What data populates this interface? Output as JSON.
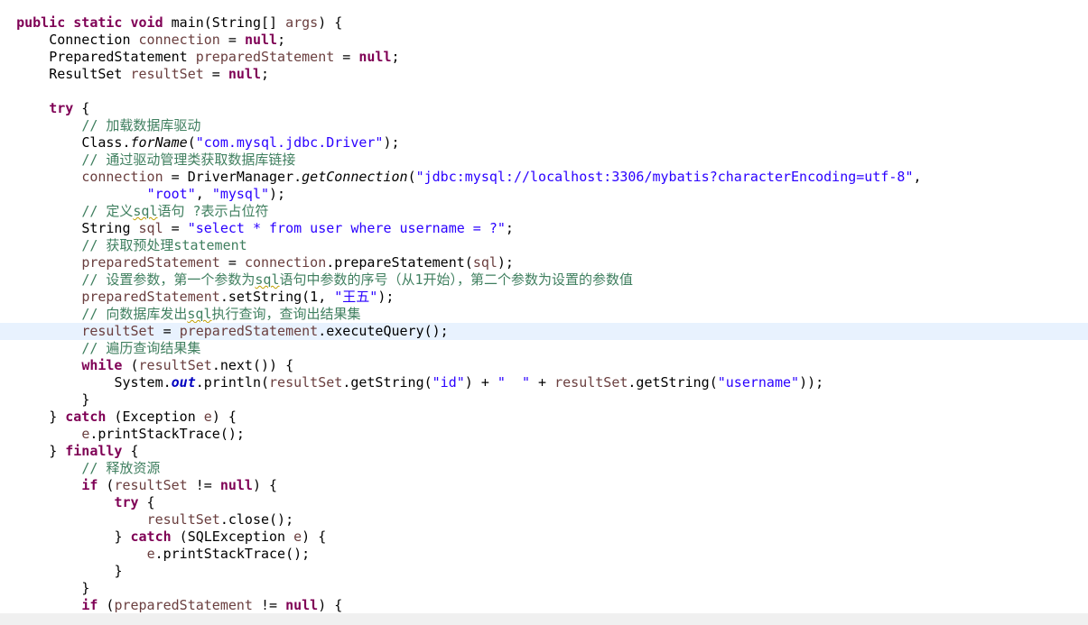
{
  "lines": {
    "l0": {
      "a": "public",
      "b": "static",
      "c": "void",
      "d": " main(String[] ",
      "e": "args",
      ")": ") {"
    },
    "l1": {
      "a": "Connection ",
      "b": "connection",
      "c": " = ",
      "d": "null",
      ";": ";"
    },
    "l2": {
      "a": "PreparedStatement ",
      "b": "preparedStatement",
      "c": " = ",
      "d": "null",
      ";": ";"
    },
    "l3": {
      "a": "ResultSet ",
      "b": "resultSet",
      "c": " = ",
      "d": "null",
      ";": ";"
    },
    "l5": {
      "a": "try",
      "b": " {"
    },
    "l6": {
      "a": "// 加载数据库驱动"
    },
    "l7": {
      "a": "Class.",
      "b": "forName",
      "c": "(",
      "d": "\"com.mysql.jdbc.Driver\"",
      "e": ");"
    },
    "l8": {
      "a": "// 通过驱动管理类获取数据库链接"
    },
    "l9": {
      "a": "connection",
      "b": " = DriverManager.",
      "c": "getConnection",
      "d": "(",
      "e": "\"jdbc:mysql://localhost:3306/mybatis?characterEncoding=utf-8\"",
      "f": ","
    },
    "l10": {
      "a": "\"root\"",
      "b": ", ",
      "c": "\"mysql\"",
      "d": ");"
    },
    "l11": {
      "a": "// 定义",
      "b": "sql",
      "c": "语句 ?表示占位符"
    },
    "l12": {
      "a": "String ",
      "b": "sql",
      "c": " = ",
      "d": "\"select * from user where username = ?\"",
      "e": ";"
    },
    "l13": {
      "a": "// 获取预处理statement"
    },
    "l14": {
      "a": "preparedStatement",
      "b": " = ",
      "c": "connection",
      "d": ".prepareStatement(",
      "e": "sql",
      "f": ");"
    },
    "l15": {
      "a": "// 设置参数，第一个参数为",
      "b": "sql",
      "c": "语句中参数的序号（从1开始），第二个参数为设置的参数值"
    },
    "l16": {
      "a": "preparedStatement",
      "b": ".setString(1, ",
      "c": "\"王五\"",
      "d": ");"
    },
    "l17": {
      "a": "// 向数据库发出",
      "b": "sql",
      "c": "执行查询，查询出结果集"
    },
    "l18": {
      "a": "resultSet",
      "b": " = ",
      "c": "preparedStatement",
      "d": ".executeQuery();"
    },
    "l19": {
      "a": "// 遍历查询结果集"
    },
    "l20": {
      "a": "while",
      "b": " (",
      "c": "resultSet",
      "d": ".next()) {"
    },
    "l21": {
      "a": "System.",
      "b": "out",
      "c": ".println(",
      "d": "resultSet",
      "e": ".getString(",
      "f": "\"id\"",
      "g": ") + ",
      "h": "\"  \"",
      "i": " + ",
      "j": "resultSet",
      "k": ".getString(",
      "l": "\"username\"",
      "m": "));"
    },
    "l22": {
      "a": "}"
    },
    "l23": {
      "a": "} ",
      "b": "catch",
      "c": " (Exception ",
      "d": "e",
      "e": ") {"
    },
    "l24": {
      "a": "e",
      "b": ".printStackTrace();"
    },
    "l25": {
      "a": "} ",
      "b": "finally",
      "c": " {"
    },
    "l26": {
      "a": "// 释放资源"
    },
    "l27": {
      "a": "if",
      "b": " (",
      "c": "resultSet",
      "d": " != ",
      "e": "null",
      "f": ") {"
    },
    "l28": {
      "a": "try",
      "b": " {"
    },
    "l29": {
      "a": "resultSet",
      "b": ".close();"
    },
    "l30": {
      "a": "} ",
      "b": "catch",
      "c": " (SQLException ",
      "d": "e",
      "e": ") {"
    },
    "l31": {
      "a": "e",
      "b": ".printStackTrace();"
    },
    "l32": {
      "a": "}"
    },
    "l33": {
      "a": "}"
    },
    "l34": {
      "a": "if",
      "b": " (",
      "c": "preparedStatement",
      "d": " != ",
      "e": "null",
      "f": ") {"
    }
  },
  "colors": {
    "keyword": "#7f0055",
    "local_variable": "#6a3e3e",
    "string": "#2a00ff",
    "comment": "#3f7f5f",
    "static_field": "#0000c0",
    "current_line": "#e8f2fe"
  }
}
